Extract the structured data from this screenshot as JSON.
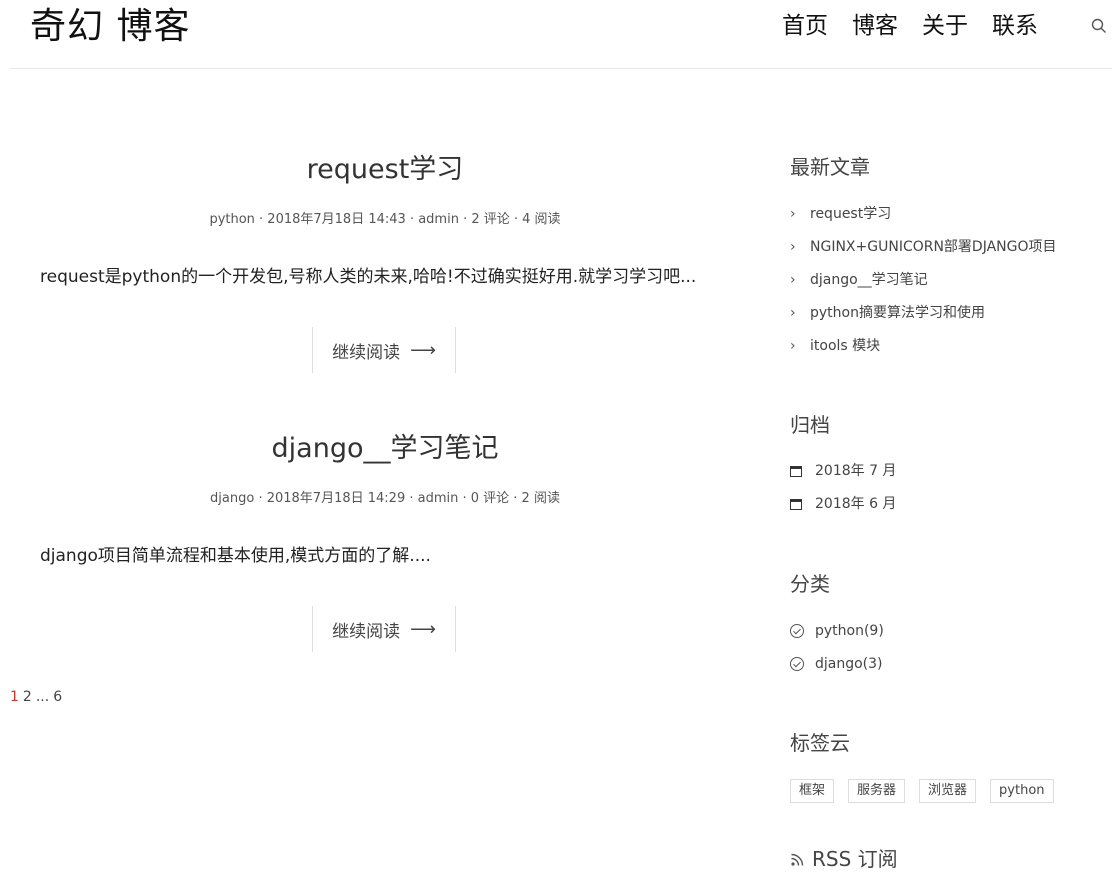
{
  "header": {
    "logo": "奇幻 博客",
    "nav": [
      "首页",
      "博客",
      "关于",
      "联系"
    ],
    "search_icon": "search-icon"
  },
  "posts": [
    {
      "title": "request学习",
      "meta": "python · 2018年7月18日 14:43 · admin · 2 评论 · 4 阅读",
      "excerpt": "request是python的一个开发包,号称人类的未来,哈哈!不过确实挺好用.就学习学习吧...",
      "read_more": "继续阅读"
    },
    {
      "title": "django__学习笔记",
      "meta": "django · 2018年7月18日 14:29 · admin · 0 评论 · 2 阅读",
      "excerpt": "django项目简单流程和基本使用,模式方面的了解....",
      "read_more": "继续阅读"
    }
  ],
  "pagination": [
    "1",
    "2",
    "...",
    "6"
  ],
  "sidebar": {
    "recent": {
      "title": "最新文章",
      "items": [
        "request学习",
        "NGINX+GUNICORN部署DJANGO项目",
        "django__学习笔记",
        "python摘要算法学习和使用",
        "itools 模块"
      ]
    },
    "archive": {
      "title": "归档",
      "items": [
        "2018年 7 月",
        "2018年 6 月"
      ]
    },
    "categories": {
      "title": "分类",
      "items": [
        "python(9)",
        "django(3)"
      ]
    },
    "tags": {
      "title": "标签云",
      "items": [
        "框架",
        "服务器",
        "浏览器",
        "python"
      ]
    },
    "rss": "RSS 订阅"
  },
  "colors": {
    "accent": "#c0392b",
    "text": "#333333",
    "border": "#dddddd"
  }
}
